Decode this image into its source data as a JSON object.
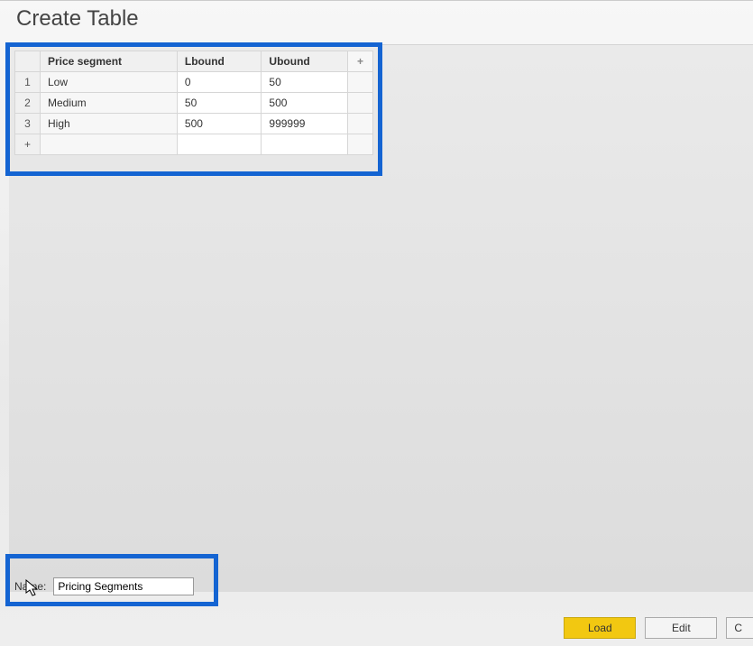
{
  "dialog": {
    "title": "Create Table"
  },
  "table": {
    "headers": {
      "col1": "Price segment",
      "col2": "Lbound",
      "col3": "Ubound",
      "addcol": "+"
    },
    "rows": [
      {
        "num": "1",
        "segment": "Low",
        "lbound": "0",
        "ubound": "50"
      },
      {
        "num": "2",
        "segment": "Medium",
        "lbound": "50",
        "ubound": "500"
      },
      {
        "num": "3",
        "segment": "High",
        "lbound": "500",
        "ubound": "999999"
      }
    ],
    "addrow": "+"
  },
  "name": {
    "label": "Name:",
    "value": "Pricing Segments"
  },
  "buttons": {
    "load": "Load",
    "edit": "Edit",
    "cancel": "C"
  }
}
